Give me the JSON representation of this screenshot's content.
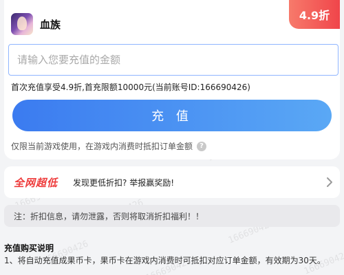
{
  "header": {
    "app_icon": "game-avatar",
    "app_name": "血族",
    "discount_tag": "4.9折"
  },
  "recharge": {
    "amount_placeholder": "请输入您要充值的金额",
    "amount_value": "",
    "first_recharge_note": "首次充值享受4.9折,首充限额10000元(当前账号ID:166690426)",
    "button_label": "充 值",
    "limit_note": "仅限当前游戏使用，在游戏内消费时抵扣订单金额",
    "help_icon_label": "?"
  },
  "report": {
    "badge": "全网超低",
    "text": "发现更低折扣? 举报赢奖励!",
    "chevron_icon": "chevron-right-icon"
  },
  "warning": {
    "text": "注：折扣信息，请勿泄露，否则将取消折扣福利！！"
  },
  "instructions": {
    "title": "充值购买说明",
    "item1": "1、将自动充值成果币卡，果币卡在游戏内消费时可抵扣对应订单金额，有效期为30天。"
  },
  "watermark": "166690426",
  "colors": {
    "accent_blue": "#4a90f0",
    "discount_red": "#f0454a",
    "badge_red": "#ee3b3b"
  }
}
